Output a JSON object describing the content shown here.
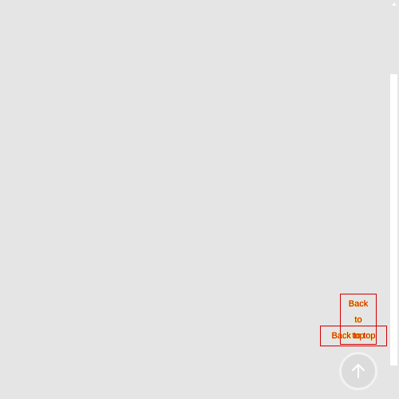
{
  "back_to_top": {
    "tooltip_vertical": "Back\nto\ntop",
    "tooltip_horizontal": "Back to top",
    "icon": "arrow-up-icon"
  },
  "colors": {
    "background": "#e5e5e5",
    "outline": "#d20000",
    "highlight": "#ffea00",
    "button_ring": "#f2f2f2"
  }
}
